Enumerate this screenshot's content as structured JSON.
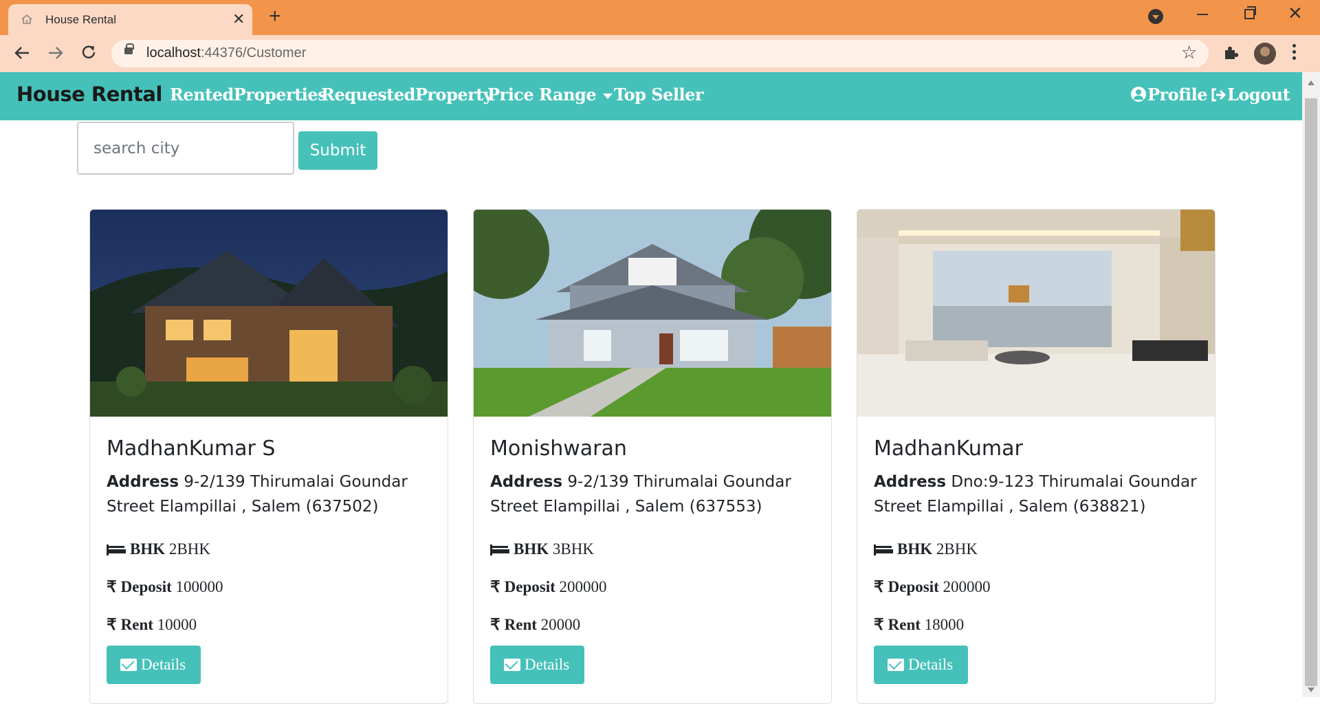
{
  "browser": {
    "tab_title": "House Rental",
    "tab_close": "✕",
    "new_tab": "+",
    "url_host": "localhost",
    "url_rest": ":44376/Customer",
    "colors": {
      "frame": "#F2954B",
      "toolbar": "#FBD9C4"
    }
  },
  "navbar": {
    "brand": "House Rental",
    "links": [
      "RentedProperties",
      "RequestedProperty",
      "Price Range",
      "Top Seller"
    ],
    "profile": "Profile",
    "logout": "Logout",
    "color": "#45C1B9"
  },
  "search": {
    "placeholder": "search city",
    "submit_label": "Submit"
  },
  "labels": {
    "address": "Address",
    "bhk": "BHK",
    "deposit": "Deposit",
    "rent": "Rent",
    "details": "Details",
    "rupee": "₹"
  },
  "cards": [
    {
      "name": "MadhanKumar S",
      "address": "9-2/139 Thirumalai Goundar Street Elampillai , Salem (637502)",
      "bhk": "2BHK",
      "deposit": "100000",
      "rent": "10000",
      "image": "night-house-photo"
    },
    {
      "name": "Monishwaran",
      "address": "9-2/139 Thirumalai Goundar Street Elampillai , Salem (637553)",
      "bhk": "3BHK",
      "deposit": "200000",
      "rent": "20000",
      "image": "day-house-photo"
    },
    {
      "name": "MadhanKumar",
      "address": "Dno:9-123 Thirumalai Goundar Street Elampillai , Salem (638821)",
      "bhk": "2BHK",
      "deposit": "200000",
      "rent": "18000",
      "image": "living-room-photo"
    }
  ]
}
